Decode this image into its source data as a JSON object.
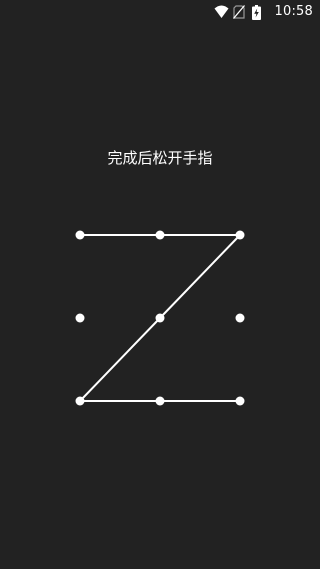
{
  "status_bar": {
    "time": "10:58",
    "icons": [
      "wifi-icon",
      "no-sim-icon",
      "battery-charging-icon"
    ]
  },
  "lock_screen": {
    "instruction": "完成后松开手指",
    "pattern": {
      "grid_size": 3,
      "sequence": [
        1,
        2,
        3,
        5,
        7,
        8,
        9
      ],
      "line_color": "#ffffff",
      "dot_color": "#ffffff"
    }
  },
  "colors": {
    "background": "#222222",
    "text": "#ffffff"
  }
}
